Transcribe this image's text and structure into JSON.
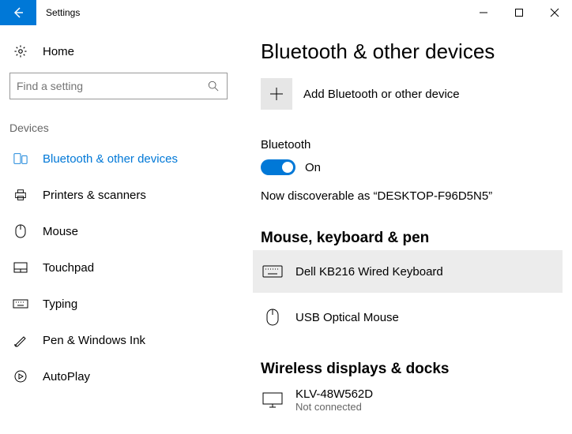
{
  "window": {
    "title": "Settings"
  },
  "sidebar": {
    "home_label": "Home",
    "search_placeholder": "Find a setting",
    "section_label": "Devices",
    "items": [
      {
        "label": "Bluetooth & other devices"
      },
      {
        "label": "Printers & scanners"
      },
      {
        "label": "Mouse"
      },
      {
        "label": "Touchpad"
      },
      {
        "label": "Typing"
      },
      {
        "label": "Pen & Windows Ink"
      },
      {
        "label": "AutoPlay"
      }
    ]
  },
  "main": {
    "title": "Bluetooth & other devices",
    "add_label": "Add Bluetooth or other device",
    "bt_label": "Bluetooth",
    "bt_state": "On",
    "discoverable": "Now discoverable as “DESKTOP-F96D5N5”",
    "cat1": "Mouse, keyboard & pen",
    "dev1": {
      "name": "Dell KB216 Wired Keyboard"
    },
    "dev2": {
      "name": "USB Optical Mouse"
    },
    "cat2": "Wireless displays & docks",
    "dev3": {
      "name": "KLV-48W562D",
      "status": "Not connected"
    }
  }
}
